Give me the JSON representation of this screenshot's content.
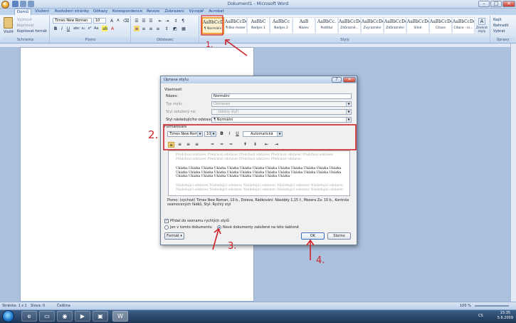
{
  "window": {
    "title": "Dokument1 - Microsoft Word",
    "controls": [
      "–",
      "□",
      "✕"
    ]
  },
  "tabs": [
    "Domů",
    "Vložení",
    "Rozložení stránky",
    "Odkazy",
    "Korespondence",
    "Revize",
    "Zobrazení",
    "Vývojář",
    "Acrobat"
  ],
  "clipboard": {
    "paste_label": "Vložit",
    "cut_label": "Vyjmout",
    "copy_label": "Kopírovat",
    "format_painter_label": "Kopírovat formát",
    "group_label": "Schránka"
  },
  "font": {
    "family": "Times New Roman",
    "size": "10",
    "group_label": "Písmo"
  },
  "paragraph": {
    "group_label": "Odstavec"
  },
  "styles": {
    "group_label": "Styly",
    "items": [
      {
        "preview": "AaBbCcDc",
        "name": "¶ Normální"
      },
      {
        "preview": "AaBbCcDc",
        "name": "¶ Bez mezer"
      },
      {
        "preview": "AaBbC",
        "name": "Nadpis 1"
      },
      {
        "preview": "AaBbCc",
        "name": "Nadpis 2"
      },
      {
        "preview": "AaB",
        "name": "Název"
      },
      {
        "preview": "AaBbCc.",
        "name": "Podtitul"
      },
      {
        "preview": "AaBbCcDc",
        "name": "Zdůrazně..."
      },
      {
        "preview": "AaBbCcDc",
        "name": "Zvýraznění"
      },
      {
        "preview": "AaBbCcDc",
        "name": "Zdůraznění"
      },
      {
        "preview": "AaBbCcDdI",
        "name": "Silné"
      },
      {
        "preview": "AaBbCcDc",
        "name": "Citace"
      },
      {
        "preview": "AaBbCcDc",
        "name": "Citace - in..."
      }
    ],
    "change_styles_label": "Změnit styly"
  },
  "editing": {
    "find_label": "Najít",
    "replace_label": "Nahradit",
    "select_label": "Vybrat",
    "group_label": "Úpravy"
  },
  "dialog": {
    "title": "Úprava stylu",
    "help": "?",
    "close": "✕",
    "properties_header": "Vlastnosti",
    "name_label": "Název:",
    "name_value": "Normální",
    "type_label": "Typ stylu:",
    "type_value": "Odstavec",
    "based_on_label": "Styl založený na:",
    "based_on_value": "(žádný styl)",
    "next_style_label": "Styl následujícího odstavce:",
    "next_style_value": "¶ Normální",
    "formatting_header": "Formátování",
    "font_value": "Times New Roman",
    "size_value": "10",
    "color_value": "Automatická",
    "preview_prev": "Předchozí odstavec Předchozí odstavec Předchozí odstavec Předchozí odstavec Předchozí odstavec Předchozí odstavec Předchozí odstavec Předchozí odstavec Předchozí odstavec",
    "preview_sample": "Ukázka Ukázka Ukázka Ukázka Ukázka Ukázka Ukázka Ukázka Ukázka Ukázka Ukázka Ukázka Ukázka Ukázka Ukázka Ukázka Ukázka Ukázka Ukázka Ukázka Ukázka Ukázka Ukázka Ukázka Ukázka Ukázka Ukázka Ukázka Ukázka Ukázka Ukázka Ukázka Ukázka Ukázka Ukázka",
    "preview_next": "Následující odstavec Následující odstavec Následující odstavec Následující odstavec Následující odstavec Následující odstavec Následující odstavec Následující odstavec Následující odstavec Následující odstavec",
    "description": "Písmo: (výchozí) Times New Roman, 10 b., Doleva, Řádkování: Násobky 1,15 ř., Mezera Za: 10 b., Kontrola osamocených řádků, Styl: Rychlý styl",
    "add_quick_label": "Přidat do seznamu rychlých stylů",
    "only_doc_label": "Jen v tomto dokumentu",
    "new_docs_label": "Nové dokumenty založené na této šabloně",
    "format_btn": "Formát ▾",
    "ok_btn": "OK",
    "cancel_btn": "Storno"
  },
  "annotations": [
    "1.",
    "2.",
    "3.",
    "4."
  ],
  "status": {
    "page": "Stránka: 1 z 1",
    "words": "Slova: 0",
    "language": "Čeština",
    "zoom": "100 %"
  },
  "taskbar": {
    "lang": "CS",
    "time": "15:35",
    "date": "5.6.2009"
  }
}
